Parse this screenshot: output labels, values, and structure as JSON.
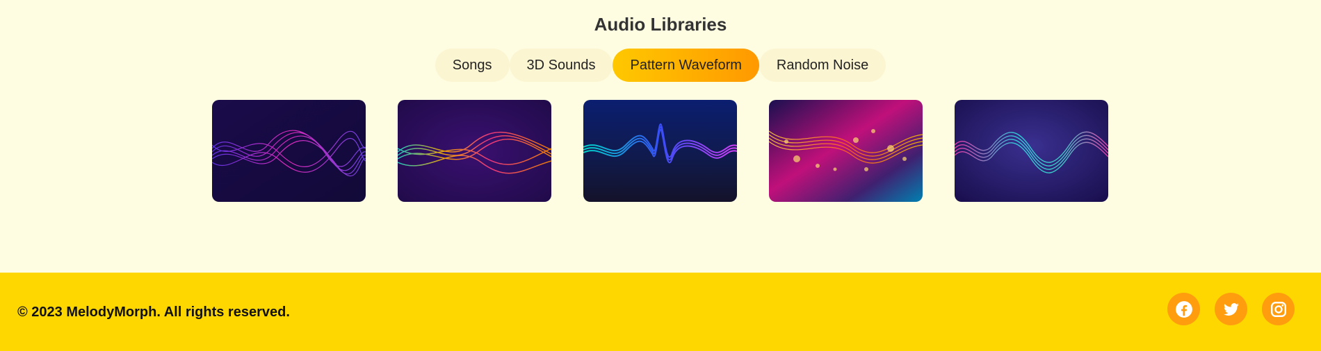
{
  "page": {
    "title": "Audio Libraries"
  },
  "tabs": [
    {
      "label": "Songs",
      "active": false
    },
    {
      "label": "3D Sounds",
      "active": false
    },
    {
      "label": "Pattern Waveform",
      "active": true
    },
    {
      "label": "Random Noise",
      "active": false
    }
  ],
  "cards": [
    {
      "image": "purple-pink-waveform"
    },
    {
      "image": "rainbow-ribbon-waveform"
    },
    {
      "image": "blue-glow-waveform"
    },
    {
      "image": "bokeh-magenta-waveform"
    },
    {
      "image": "cyan-pink-waveform"
    }
  ],
  "footer": {
    "copyright": "© 2023 MelodyMorph. All rights reserved.",
    "socials": [
      {
        "icon": "facebook-icon"
      },
      {
        "icon": "twitter-icon"
      },
      {
        "icon": "instagram-icon"
      }
    ]
  },
  "colors": {
    "background": "#fefde1",
    "tab_bg": "#fcf5d2",
    "active_tab_start": "#ffc800",
    "active_tab_end": "#ff9900",
    "footer_bg": "#ffd700",
    "social_bg": "#ff9d0f"
  }
}
